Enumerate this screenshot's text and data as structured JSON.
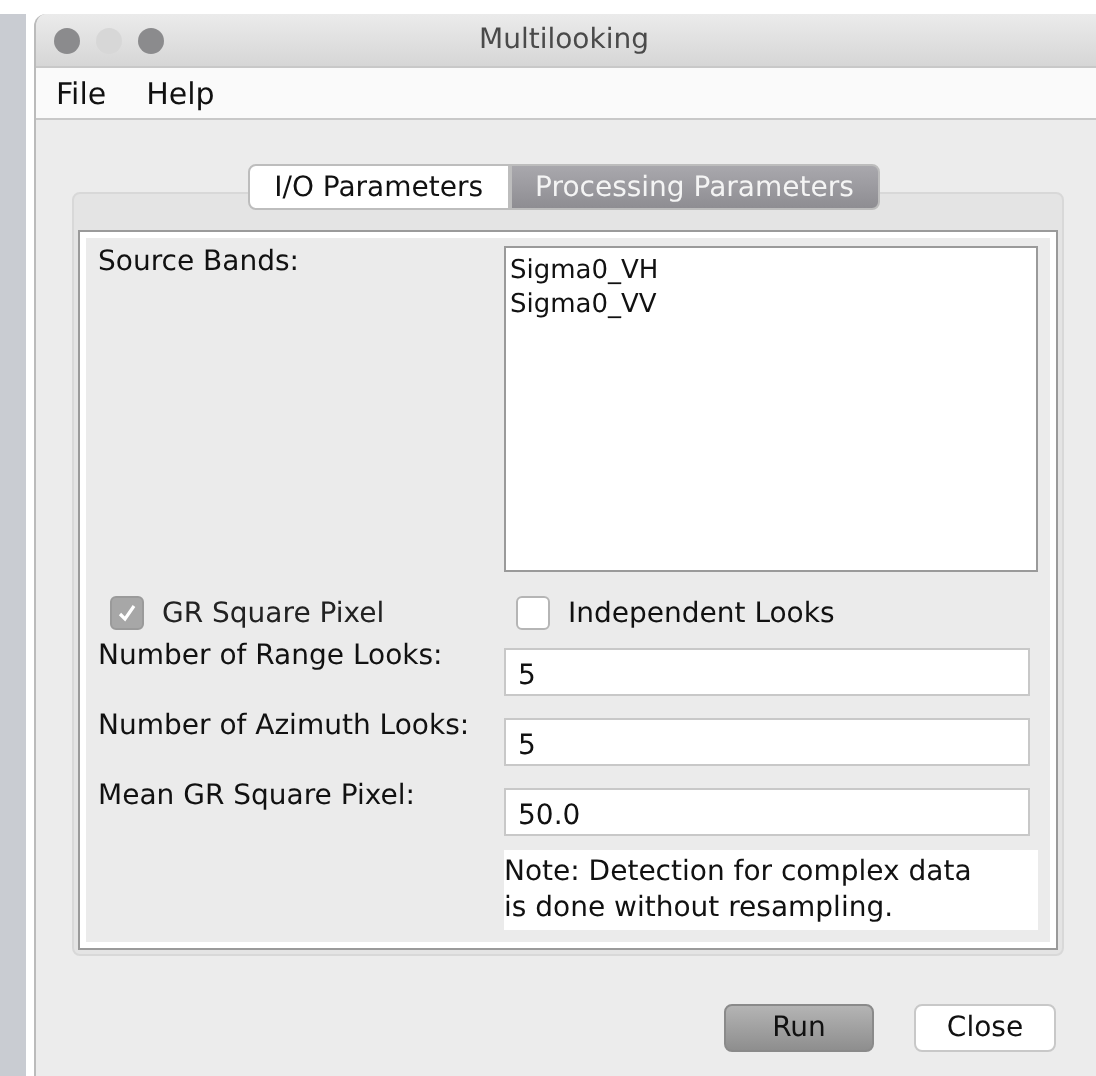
{
  "window": {
    "title": "Multilooking"
  },
  "menu": [
    "File",
    "Help"
  ],
  "tabs": [
    {
      "label": "I/O Parameters",
      "selected": false
    },
    {
      "label": "Processing Parameters",
      "selected": true
    }
  ],
  "source_bands": {
    "label": "Source Bands:",
    "items": [
      "Sigma0_VH",
      "Sigma0_VV"
    ]
  },
  "checkboxes": [
    {
      "label": "GR Square Pixel",
      "checked": true,
      "disabled": true
    },
    {
      "label": "Independent Looks",
      "checked": false,
      "disabled": false
    }
  ],
  "fields": [
    {
      "label": "Number of Range Looks:",
      "value": "5"
    },
    {
      "label": "Number of Azimuth Looks:",
      "value": "5"
    },
    {
      "label": "Mean GR Square Pixel:",
      "value": "50.0"
    }
  ],
  "note": [
    "Note: Detection for complex data",
    "is done without resampling."
  ],
  "buttons": [
    {
      "label": "Run",
      "default": true
    },
    {
      "label": "Close",
      "default": false
    }
  ]
}
